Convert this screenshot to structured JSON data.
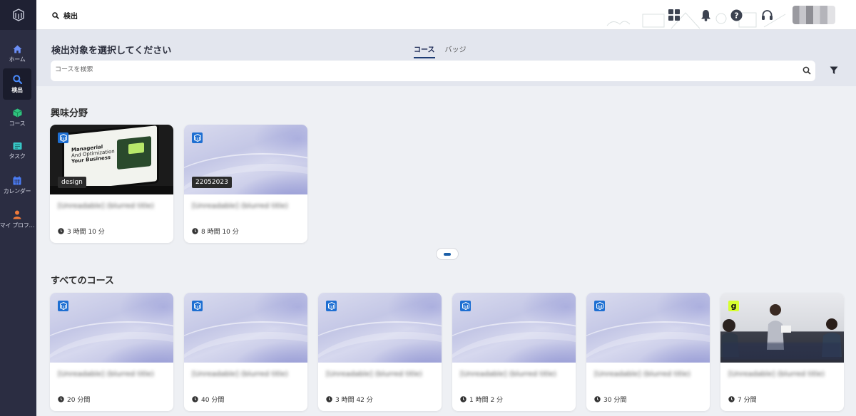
{
  "topbar": {
    "breadcrumb": "検出"
  },
  "sidebar": {
    "items": [
      {
        "label": "ホーム",
        "icon": "home-icon",
        "color": "#6b8ef5"
      },
      {
        "label": "検出",
        "icon": "search-icon",
        "color": "#4a8cff",
        "active": true
      },
      {
        "label": "コース",
        "icon": "cube-icon",
        "color": "#2ec27e"
      },
      {
        "label": "タスク",
        "icon": "task-icon",
        "color": "#37c5c5"
      },
      {
        "label": "カレンダー",
        "icon": "calendar-icon",
        "color": "#4a7cf5"
      },
      {
        "label": "マイ プロフ…",
        "icon": "user-icon",
        "color": "#f07a3a"
      }
    ]
  },
  "search_panel": {
    "title": "検出対象を選択してください",
    "tabs": [
      {
        "label": "コース",
        "active": true
      },
      {
        "label": "バッジ",
        "active": false
      }
    ],
    "placeholder": "コースを検索"
  },
  "interests": {
    "title": "興味分野",
    "cards": [
      {
        "tag": "design",
        "title": "[Unreadable] (blurred title)",
        "duration": "3 時間 10 分"
      },
      {
        "tag": "22052023",
        "title": "[Unreadable] (blurred title)",
        "duration": "8 時間 10 分"
      }
    ]
  },
  "all_courses": {
    "title": "すべてのコース",
    "cards": [
      {
        "title": "[Unreadable] (blurred title)",
        "duration": "20 分間"
      },
      {
        "title": "[Unreadable] (blurred title)",
        "duration": "40 分間"
      },
      {
        "title": "[Unreadable] (blurred title)",
        "duration": "3 時間 42 分"
      },
      {
        "title": "[Unreadable] (blurred title)",
        "duration": "1 時間 2 分"
      },
      {
        "title": "[Unreadable] (blurred title)",
        "duration": "30 分間"
      },
      {
        "title": "[Unreadable] (blurred title)",
        "duration": "7 分間",
        "badge_letter": "g"
      }
    ]
  },
  "laptop_mock": {
    "line1": "Managerial",
    "line2": "And Optimization",
    "line3": "Your Business"
  },
  "colors": {
    "accent": "#1e6fd2",
    "sidebar_bg": "#2b2d42",
    "panel_bg": "#e3e6ee"
  }
}
